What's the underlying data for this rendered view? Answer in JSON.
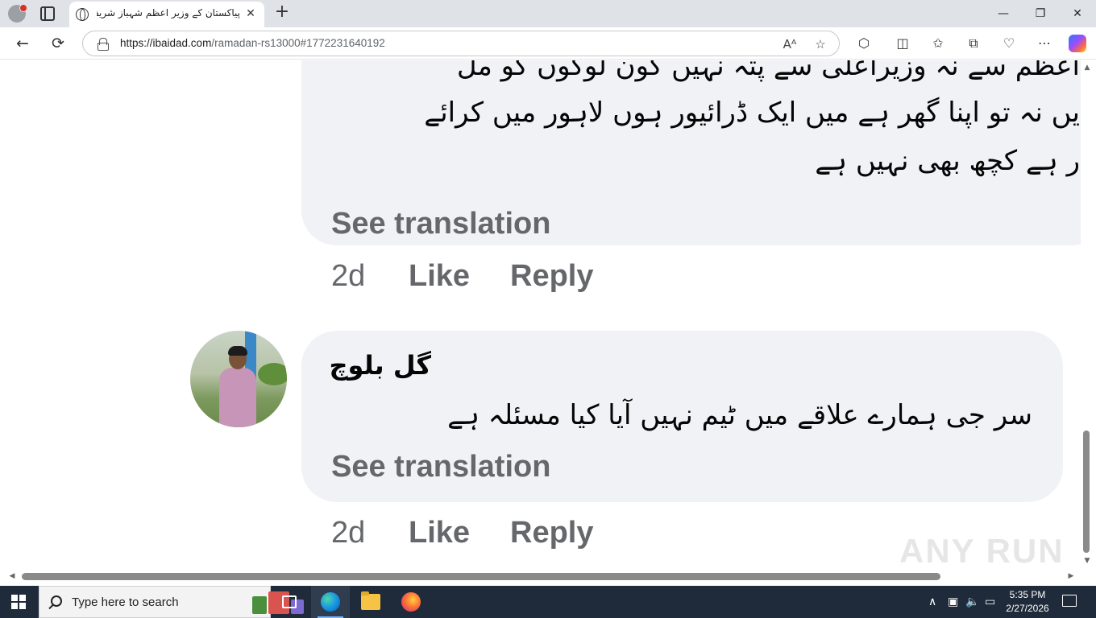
{
  "browser": {
    "tab_title": "پیاکستان کے وزیر اعظم شہباز شریف",
    "tab_close": "✕",
    "new_tab": "+",
    "url_host": "https://ibaidad.com",
    "url_path": "/ramadan-rs13000#1772231640192",
    "window_controls": {
      "minimize": "—",
      "restore": "❐",
      "close": "✕"
    },
    "nav": {
      "back": "←",
      "reload": "⟳"
    },
    "icons": [
      "profile-icon",
      "tab-actions-icon",
      "globe-icon",
      "lock-icon",
      "read-aloud-icon",
      "favorite-star-icon",
      "extensions-icon",
      "split-screen-icon",
      "favorites-icon",
      "collections-icon",
      "browser-essentials-icon",
      "more-icon",
      "copilot-icon"
    ]
  },
  "comments": [
    {
      "lines": [
        "اعظم سے نہ وزیراعلی سے پتہ نہیں کون لوگوں کو مل",
        "یں نہ تو اپنا گھر ہے میں ایک ڈرائیور ہوں لاہور میں کرائے",
        "ر ہے کچھ بھی نہیں ہے"
      ],
      "see_translation": "See translation",
      "time": "2d",
      "like": "Like",
      "reply": "Reply"
    },
    {
      "author": "گل بلوچ",
      "text": "سر جی ہمارے علاقے میں ٹیم نہیں آیا کیا مسئلہ ہے",
      "see_translation": "See translation",
      "time": "2d",
      "like": "Like",
      "reply": "Reply"
    }
  ],
  "watermark": "ANY RUN",
  "taskbar": {
    "search_placeholder": "Type here to search",
    "time": "5:35 PM",
    "date": "2/27/2026"
  },
  "colors": {
    "bubble": "#f0f2f5",
    "secondary_text": "#65676b",
    "primary_text": "#050505",
    "taskbar": "#1f2b3a"
  }
}
